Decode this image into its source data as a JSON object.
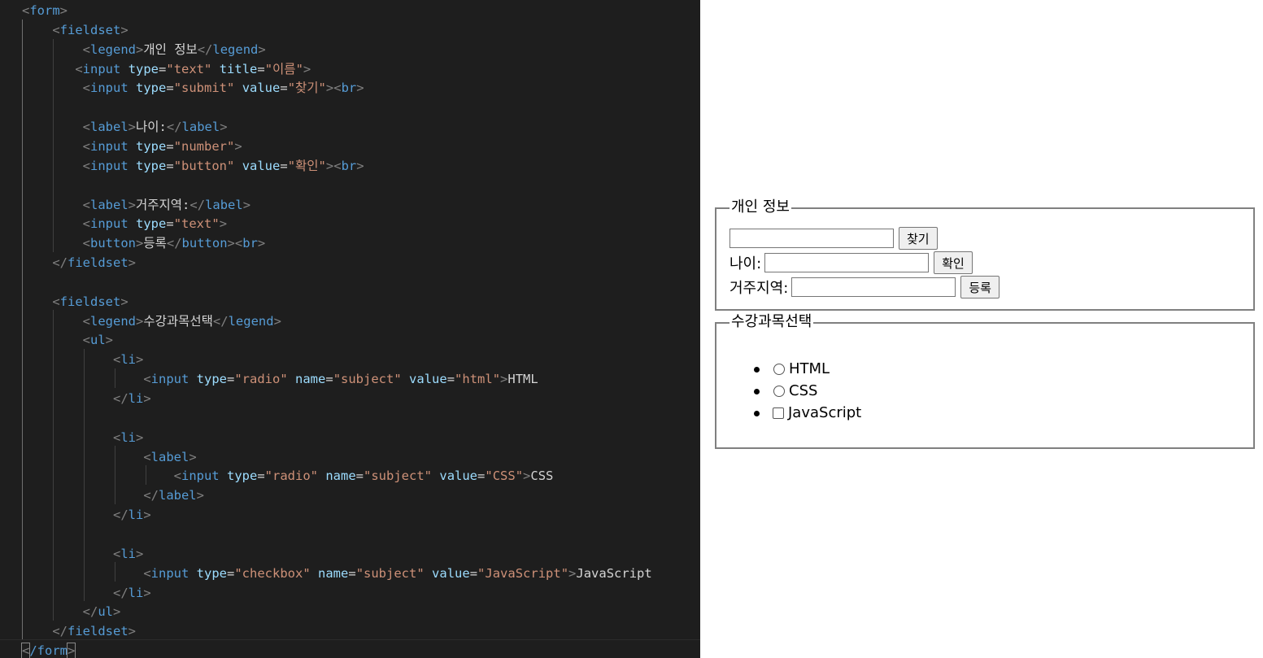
{
  "editor": {
    "lines": [
      [
        [
          "br",
          "<"
        ],
        [
          "tag",
          "form"
        ],
        [
          "br",
          ">"
        ]
      ],
      [
        [
          "sp",
          "    "
        ],
        [
          "br",
          "<"
        ],
        [
          "tag",
          "fieldset"
        ],
        [
          "br",
          ">"
        ]
      ],
      [
        [
          "sp",
          "        "
        ],
        [
          "br",
          "<"
        ],
        [
          "tag",
          "legend"
        ],
        [
          "br",
          ">"
        ],
        [
          "txt",
          "개인 정보"
        ],
        [
          "br",
          "</"
        ],
        [
          "tag",
          "legend"
        ],
        [
          "br",
          ">"
        ]
      ],
      [
        [
          "sp",
          "       "
        ],
        [
          "br",
          "<"
        ],
        [
          "tag",
          "input"
        ],
        [
          "sp",
          " "
        ],
        [
          "attr",
          "type"
        ],
        [
          "eq",
          "="
        ],
        [
          "str",
          "\"text\""
        ],
        [
          "sp",
          " "
        ],
        [
          "attr",
          "title"
        ],
        [
          "eq",
          "="
        ],
        [
          "str",
          "\"이름\""
        ],
        [
          "br",
          ">"
        ]
      ],
      [
        [
          "sp",
          "        "
        ],
        [
          "br",
          "<"
        ],
        [
          "tag",
          "input"
        ],
        [
          "sp",
          " "
        ],
        [
          "attr",
          "type"
        ],
        [
          "eq",
          "="
        ],
        [
          "str",
          "\"submit\""
        ],
        [
          "sp",
          " "
        ],
        [
          "attr",
          "value"
        ],
        [
          "eq",
          "="
        ],
        [
          "str",
          "\"찾기\""
        ],
        [
          "br",
          ">"
        ],
        [
          "br",
          "<"
        ],
        [
          "tag",
          "br"
        ],
        [
          "br",
          ">"
        ]
      ],
      [],
      [
        [
          "sp",
          "        "
        ],
        [
          "br",
          "<"
        ],
        [
          "tag",
          "label"
        ],
        [
          "br",
          ">"
        ],
        [
          "txt",
          "나이:"
        ],
        [
          "br",
          "</"
        ],
        [
          "tag",
          "label"
        ],
        [
          "br",
          ">"
        ]
      ],
      [
        [
          "sp",
          "        "
        ],
        [
          "br",
          "<"
        ],
        [
          "tag",
          "input"
        ],
        [
          "sp",
          " "
        ],
        [
          "attr",
          "type"
        ],
        [
          "eq",
          "="
        ],
        [
          "str",
          "\"number\""
        ],
        [
          "br",
          ">"
        ]
      ],
      [
        [
          "sp",
          "        "
        ],
        [
          "br",
          "<"
        ],
        [
          "tag",
          "input"
        ],
        [
          "sp",
          " "
        ],
        [
          "attr",
          "type"
        ],
        [
          "eq",
          "="
        ],
        [
          "str",
          "\"button\""
        ],
        [
          "sp",
          " "
        ],
        [
          "attr",
          "value"
        ],
        [
          "eq",
          "="
        ],
        [
          "str",
          "\"확인\""
        ],
        [
          "br",
          ">"
        ],
        [
          "br",
          "<"
        ],
        [
          "tag",
          "br"
        ],
        [
          "br",
          ">"
        ]
      ],
      [],
      [
        [
          "sp",
          "        "
        ],
        [
          "br",
          "<"
        ],
        [
          "tag",
          "label"
        ],
        [
          "br",
          ">"
        ],
        [
          "txt",
          "거주지역:"
        ],
        [
          "br",
          "</"
        ],
        [
          "tag",
          "label"
        ],
        [
          "br",
          ">"
        ]
      ],
      [
        [
          "sp",
          "        "
        ],
        [
          "br",
          "<"
        ],
        [
          "tag",
          "input"
        ],
        [
          "sp",
          " "
        ],
        [
          "attr",
          "type"
        ],
        [
          "eq",
          "="
        ],
        [
          "str",
          "\"text\""
        ],
        [
          "br",
          ">"
        ]
      ],
      [
        [
          "sp",
          "        "
        ],
        [
          "br",
          "<"
        ],
        [
          "tag",
          "button"
        ],
        [
          "br",
          ">"
        ],
        [
          "txt",
          "등록"
        ],
        [
          "br",
          "</"
        ],
        [
          "tag",
          "button"
        ],
        [
          "br",
          ">"
        ],
        [
          "br",
          "<"
        ],
        [
          "tag",
          "br"
        ],
        [
          "br",
          ">"
        ]
      ],
      [
        [
          "sp",
          "    "
        ],
        [
          "br",
          "</"
        ],
        [
          "tag",
          "fieldset"
        ],
        [
          "br",
          ">"
        ]
      ],
      [],
      [
        [
          "sp",
          "    "
        ],
        [
          "br",
          "<"
        ],
        [
          "tag",
          "fieldset"
        ],
        [
          "br",
          ">"
        ]
      ],
      [
        [
          "sp",
          "        "
        ],
        [
          "br",
          "<"
        ],
        [
          "tag",
          "legend"
        ],
        [
          "br",
          ">"
        ],
        [
          "txt",
          "수강과목선택"
        ],
        [
          "br",
          "</"
        ],
        [
          "tag",
          "legend"
        ],
        [
          "br",
          ">"
        ]
      ],
      [
        [
          "sp",
          "        "
        ],
        [
          "br",
          "<"
        ],
        [
          "tag",
          "ul"
        ],
        [
          "br",
          ">"
        ]
      ],
      [
        [
          "sp",
          "            "
        ],
        [
          "br",
          "<"
        ],
        [
          "tag",
          "li"
        ],
        [
          "br",
          ">"
        ]
      ],
      [
        [
          "sp",
          "                "
        ],
        [
          "br",
          "<"
        ],
        [
          "tag",
          "input"
        ],
        [
          "sp",
          " "
        ],
        [
          "attr",
          "type"
        ],
        [
          "eq",
          "="
        ],
        [
          "str",
          "\"radio\""
        ],
        [
          "sp",
          " "
        ],
        [
          "attr",
          "name"
        ],
        [
          "eq",
          "="
        ],
        [
          "str",
          "\"subject\""
        ],
        [
          "sp",
          " "
        ],
        [
          "attr",
          "value"
        ],
        [
          "eq",
          "="
        ],
        [
          "str",
          "\"html\""
        ],
        [
          "br",
          ">"
        ],
        [
          "txt",
          "HTML"
        ]
      ],
      [
        [
          "sp",
          "            "
        ],
        [
          "br",
          "</"
        ],
        [
          "tag",
          "li"
        ],
        [
          "br",
          ">"
        ]
      ],
      [],
      [
        [
          "sp",
          "            "
        ],
        [
          "br",
          "<"
        ],
        [
          "tag",
          "li"
        ],
        [
          "br",
          ">"
        ]
      ],
      [
        [
          "sp",
          "                "
        ],
        [
          "br",
          "<"
        ],
        [
          "tag",
          "label"
        ],
        [
          "br",
          ">"
        ]
      ],
      [
        [
          "sp",
          "                    "
        ],
        [
          "br",
          "<"
        ],
        [
          "tag",
          "input"
        ],
        [
          "sp",
          " "
        ],
        [
          "attr",
          "type"
        ],
        [
          "eq",
          "="
        ],
        [
          "str",
          "\"radio\""
        ],
        [
          "sp",
          " "
        ],
        [
          "attr",
          "name"
        ],
        [
          "eq",
          "="
        ],
        [
          "str",
          "\"subject\""
        ],
        [
          "sp",
          " "
        ],
        [
          "attr",
          "value"
        ],
        [
          "eq",
          "="
        ],
        [
          "str",
          "\"CSS\""
        ],
        [
          "br",
          ">"
        ],
        [
          "txt",
          "CSS"
        ]
      ],
      [
        [
          "sp",
          "                "
        ],
        [
          "br",
          "</"
        ],
        [
          "tag",
          "label"
        ],
        [
          "br",
          ">"
        ]
      ],
      [
        [
          "sp",
          "            "
        ],
        [
          "br",
          "</"
        ],
        [
          "tag",
          "li"
        ],
        [
          "br",
          ">"
        ]
      ],
      [],
      [
        [
          "sp",
          "            "
        ],
        [
          "br",
          "<"
        ],
        [
          "tag",
          "li"
        ],
        [
          "br",
          ">"
        ]
      ],
      [
        [
          "sp",
          "                "
        ],
        [
          "br",
          "<"
        ],
        [
          "tag",
          "input"
        ],
        [
          "sp",
          " "
        ],
        [
          "attr",
          "type"
        ],
        [
          "eq",
          "="
        ],
        [
          "str",
          "\"checkbox\""
        ],
        [
          "sp",
          " "
        ],
        [
          "attr",
          "name"
        ],
        [
          "eq",
          "="
        ],
        [
          "str",
          "\"subject\""
        ],
        [
          "sp",
          " "
        ],
        [
          "attr",
          "value"
        ],
        [
          "eq",
          "="
        ],
        [
          "str",
          "\"JavaScript\""
        ],
        [
          "br",
          ">"
        ],
        [
          "txt",
          "JavaScript"
        ]
      ],
      [
        [
          "sp",
          "            "
        ],
        [
          "br",
          "</"
        ],
        [
          "tag",
          "li"
        ],
        [
          "br",
          ">"
        ]
      ],
      [
        [
          "sp",
          "        "
        ],
        [
          "br",
          "</"
        ],
        [
          "tag",
          "ul"
        ],
        [
          "br",
          ">"
        ]
      ],
      [
        [
          "sp",
          "    "
        ],
        [
          "br",
          "</"
        ],
        [
          "tag",
          "fieldset"
        ],
        [
          "br",
          ">"
        ]
      ],
      [
        [
          "br",
          "<"
        ],
        [
          "tag",
          "/form"
        ],
        [
          "br",
          ">"
        ]
      ]
    ]
  },
  "preview": {
    "fieldset1": {
      "legend": "개인 정보",
      "search_button": "찾기",
      "age_label": "나이:",
      "confirm_button": "확인",
      "region_label": "거주지역:",
      "register_button": "등록"
    },
    "fieldset2": {
      "legend": "수강과목선택",
      "items": [
        {
          "label": "HTML",
          "control": "radio"
        },
        {
          "label": "CSS",
          "control": "radio"
        },
        {
          "label": "JavaScript",
          "control": "checkbox"
        }
      ]
    }
  },
  "colors": {
    "editor_bg": "#1e1e1e",
    "tag": "#569cd6",
    "bracket": "#808080",
    "attribute": "#9cdcfe",
    "string": "#ce9178",
    "text": "#d4d4d4"
  }
}
